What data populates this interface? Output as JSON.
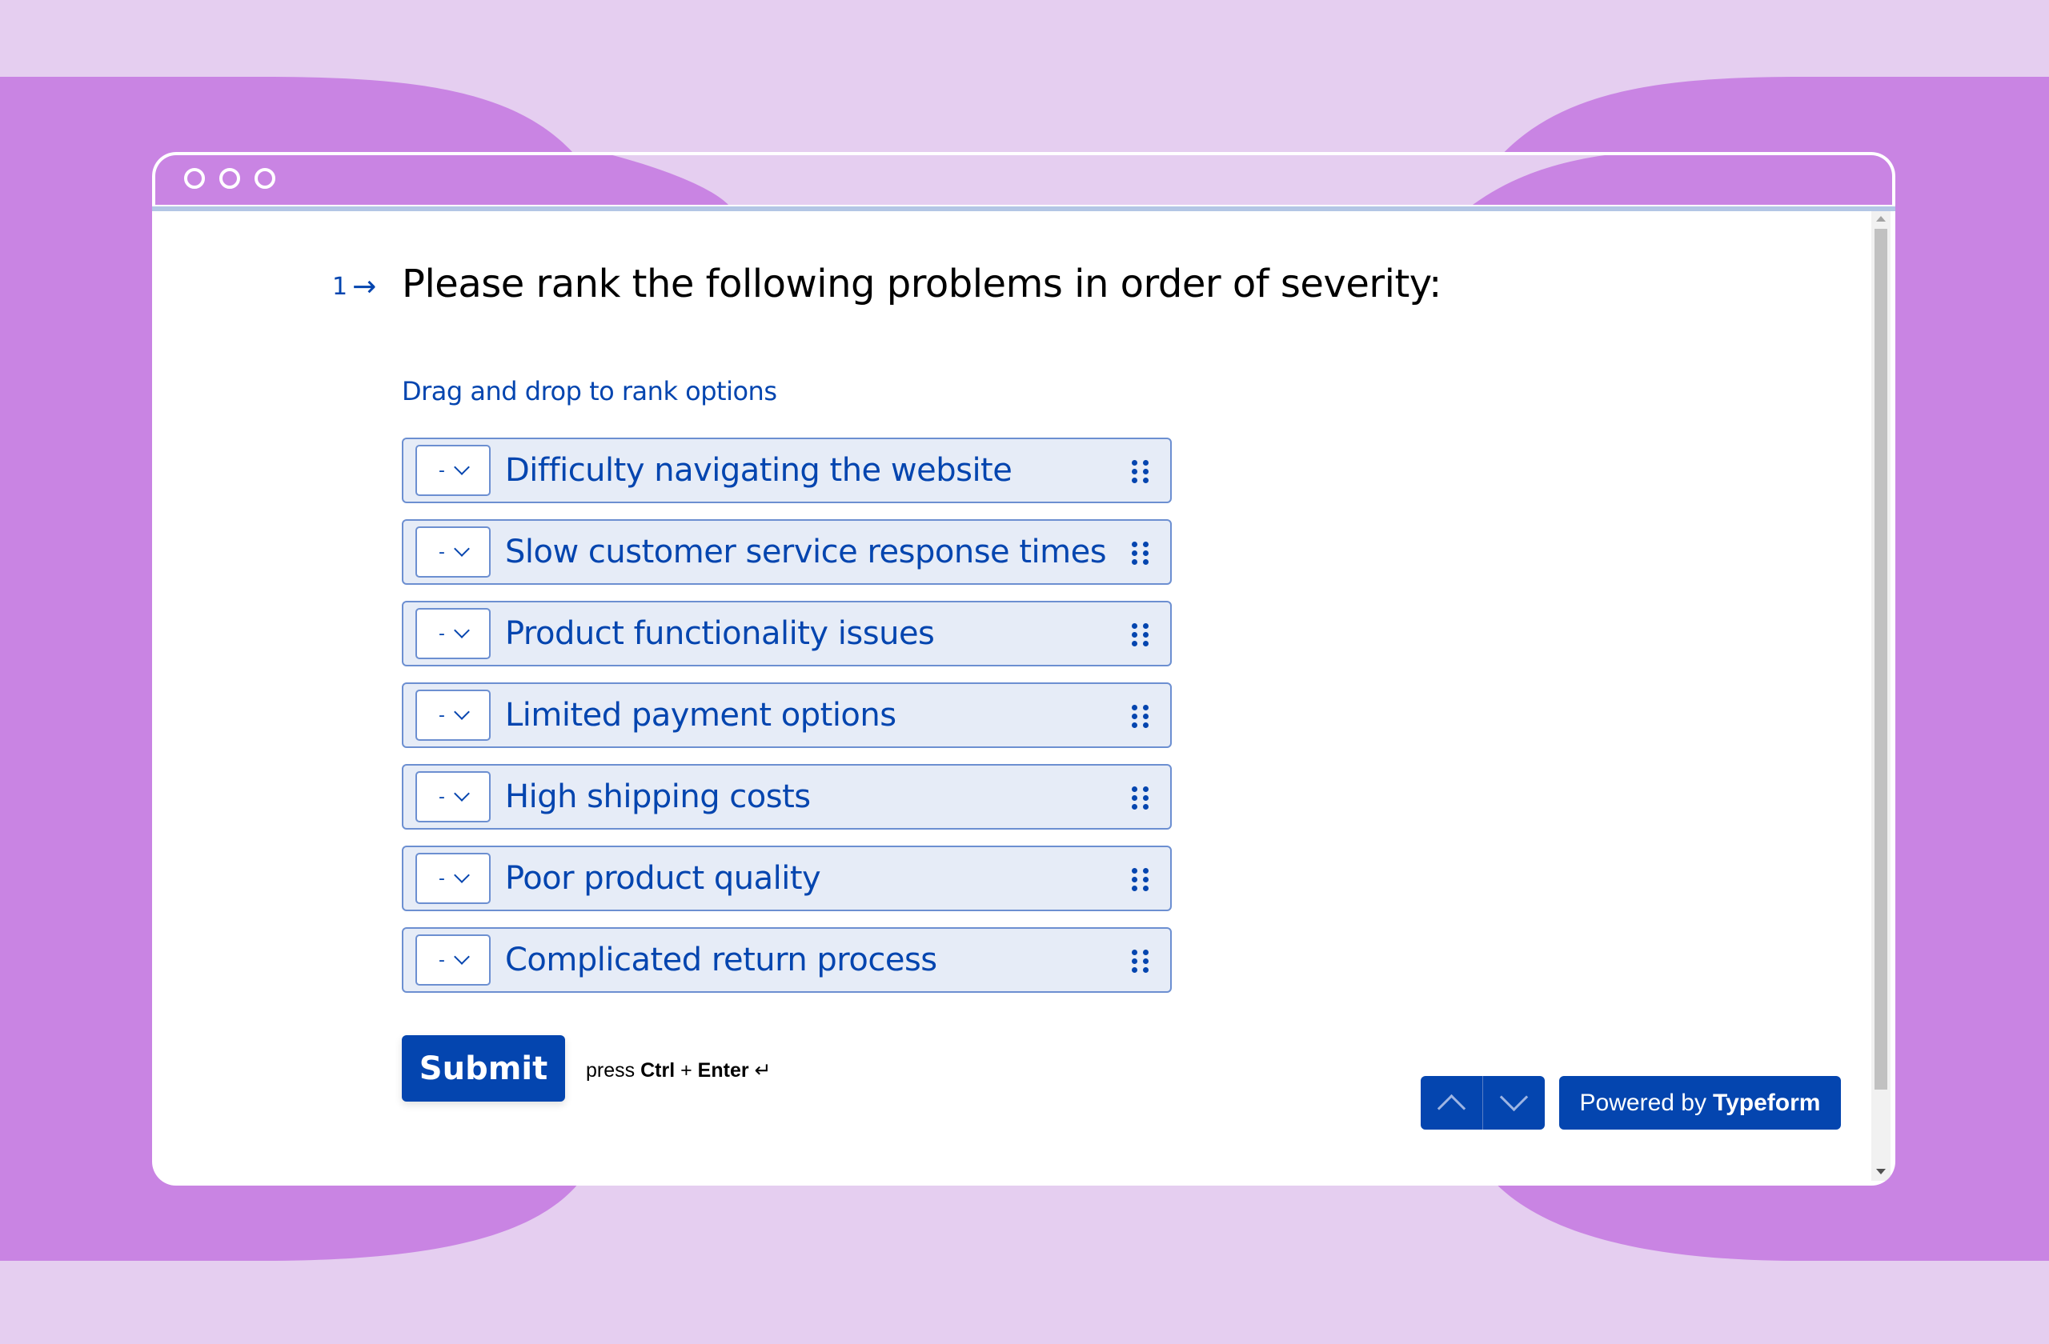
{
  "window": {
    "controls": [
      "circle",
      "circle",
      "circle"
    ]
  },
  "question": {
    "number": "1",
    "arrow_icon": "arrow-right-icon",
    "text": "Please rank the following problems in order of severity:",
    "hint": "Drag and drop to rank options"
  },
  "options": [
    {
      "rank": "-",
      "label": "Difficulty navigating the website"
    },
    {
      "rank": "-",
      "label": "Slow customer service response times"
    },
    {
      "rank": "-",
      "label": "Product functionality issues"
    },
    {
      "rank": "-",
      "label": "Limited payment options"
    },
    {
      "rank": "-",
      "label": "High shipping costs"
    },
    {
      "rank": "-",
      "label": "Poor product quality"
    },
    {
      "rank": "-",
      "label": "Complicated return process"
    }
  ],
  "actions": {
    "submit_label": "Submit",
    "press": "press",
    "key1": "Ctrl",
    "plus": "+",
    "key2": "Enter",
    "enter_glyph": "↵"
  },
  "footer": {
    "powered_prefix": "Powered by",
    "powered_brand": "Typeform"
  },
  "colors": {
    "accent": "#0445af",
    "background_light": "#e5cef0",
    "background_purple": "#c984e3",
    "option_bg": "#e6ecf7"
  }
}
